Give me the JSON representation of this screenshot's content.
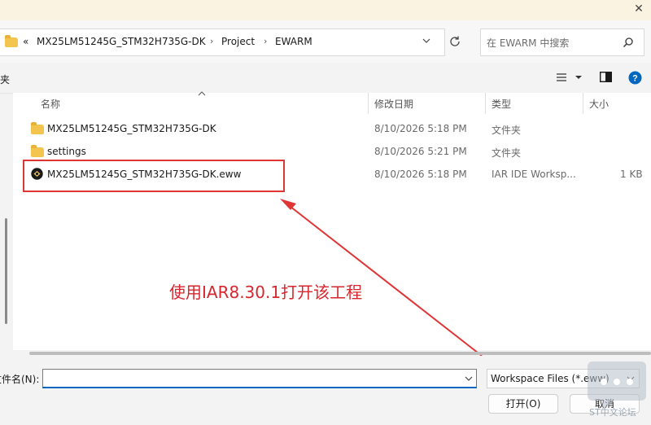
{
  "address": {
    "overflow": "«",
    "crumbs": [
      "MX25LM51245G_STM32H735G-DK",
      "Project",
      "EWARM"
    ]
  },
  "search": {
    "placeholder": "在 EWARM 中搜索"
  },
  "toolbar": {
    "left_fragment": "夹"
  },
  "columns": {
    "name": "名称",
    "date": "修改日期",
    "type": "类型",
    "size": "大小"
  },
  "files": [
    {
      "name": "MX25LM51245G_STM32H735G-DK",
      "date": "8/10/2026 5:18 PM",
      "type": "文件夹",
      "size": "",
      "icon": "folder-icon"
    },
    {
      "name": "settings",
      "date": "8/10/2026 5:21 PM",
      "type": "文件夹",
      "size": "",
      "icon": "folder-icon"
    },
    {
      "name": "MX25LM51245G_STM32H735G-DK.eww",
      "date": "8/10/2026 5:18 PM",
      "type": "IAR IDE Worksp...",
      "size": "1 KB",
      "icon": "iar-workspace-icon"
    }
  ],
  "annotation": {
    "text": "使用IAR8.30.1打开该工程",
    "color": "#d7262e"
  },
  "bottom": {
    "filename_label": "文件名(N):",
    "filename_value": "",
    "filter_value": "Workspace Files (*.eww)",
    "open_label": "打开(O)",
    "cancel_label": "取消"
  },
  "watermark": {
    "text": "ST中文论坛"
  },
  "colors": {
    "accent": "#0067c0",
    "folder": "#f3c44e",
    "annotation": "#e03535"
  }
}
